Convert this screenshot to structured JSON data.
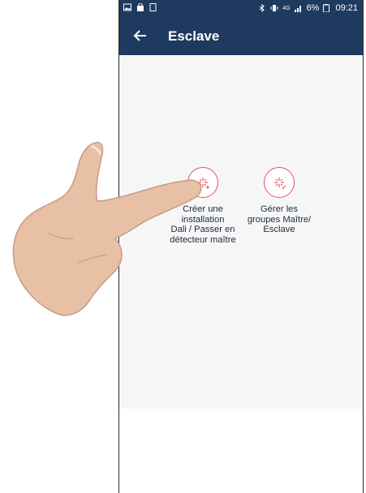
{
  "status_bar": {
    "battery": "6%",
    "time": "09:21",
    "network": "4G"
  },
  "app_bar": {
    "title": "Esclave"
  },
  "options": [
    {
      "label_lines": [
        "Créer une",
        "installation",
        "Dali / Passer en",
        "détecteur maître"
      ]
    },
    {
      "label_lines": [
        "Gérer les",
        "groupes Maître/",
        "Esclave"
      ]
    }
  ],
  "colors": {
    "header": "#1e3a5f",
    "accent": "#e0575f",
    "background": "#f6f6f7"
  }
}
